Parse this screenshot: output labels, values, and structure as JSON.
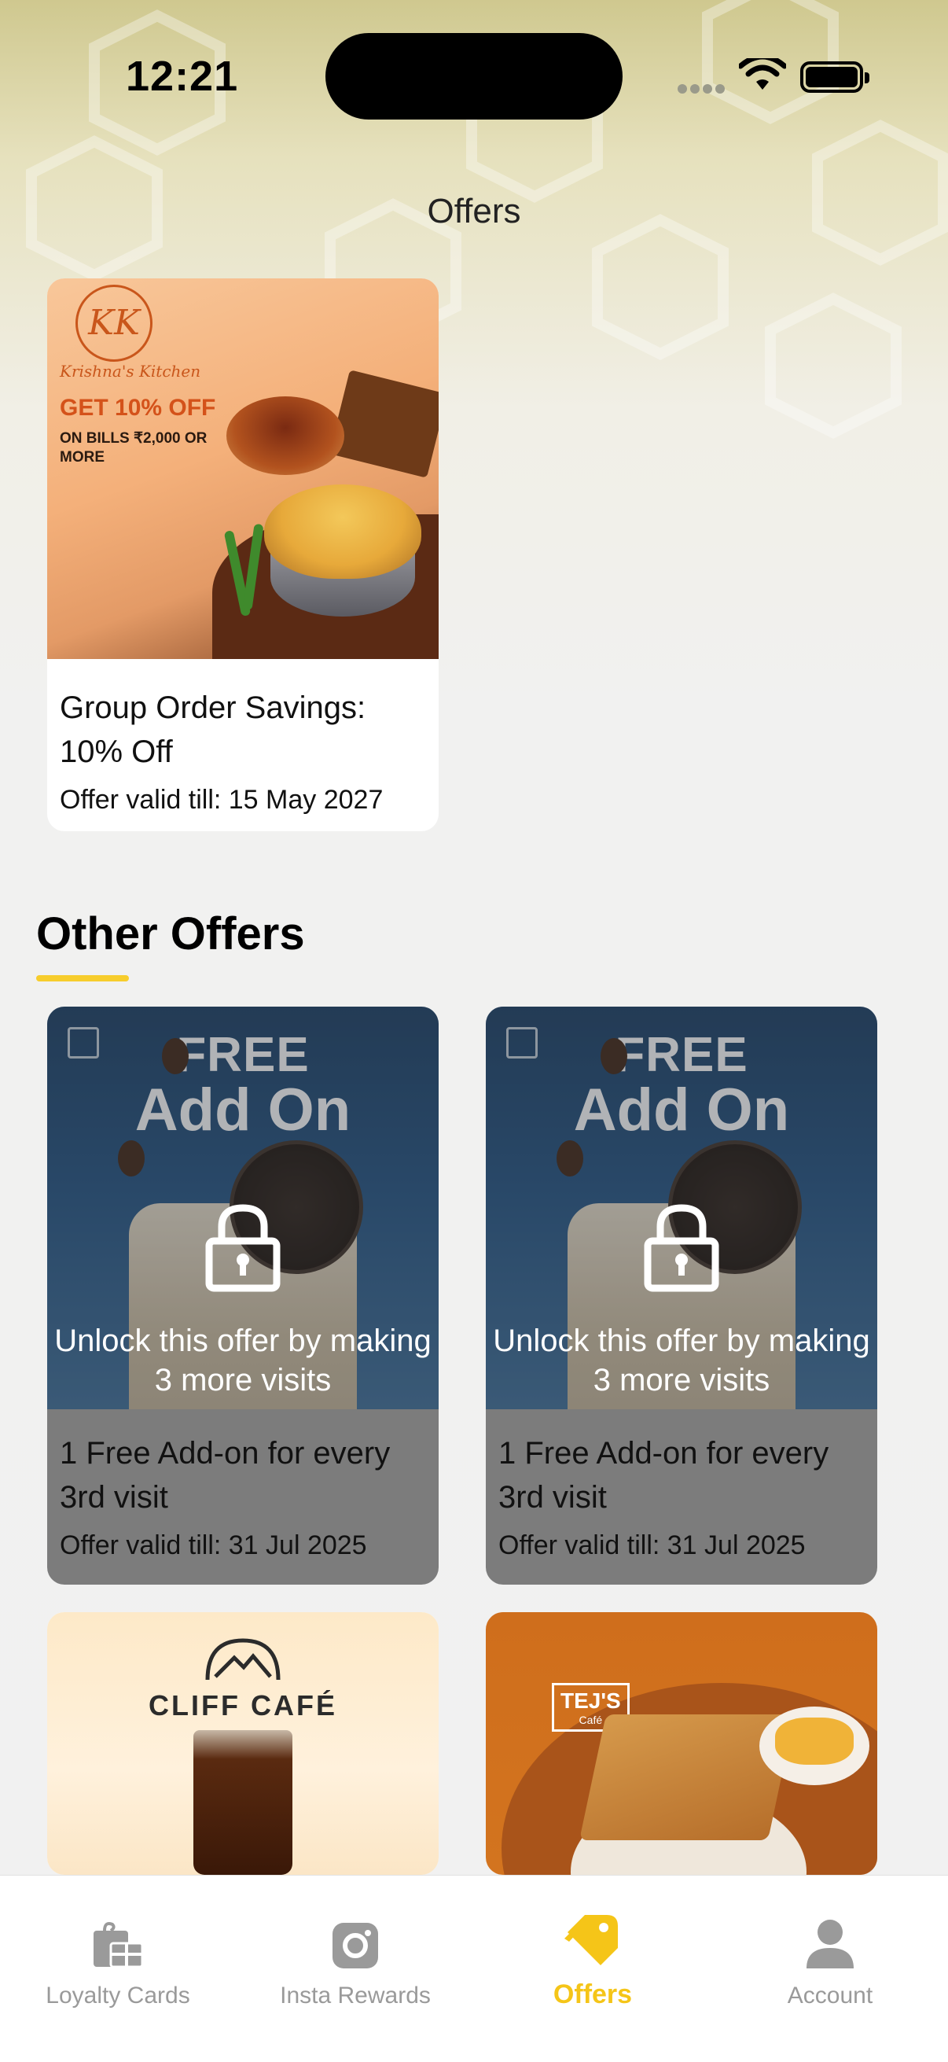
{
  "status_bar": {
    "time": "12:21"
  },
  "header": {
    "title": "Offers"
  },
  "featured_offer": {
    "brand": "Krishna's Kitchen",
    "logo_text": "KK",
    "banner_headline": "GET 10% OFF",
    "banner_sub": "ON BILLS ₹2,000 OR MORE",
    "title": "Group Order Savings: 10% Off",
    "valid": "Offer valid till: 15 May 2027"
  },
  "other_offers": {
    "heading": "Other Offers",
    "items": [
      {
        "banner_line1": "FREE",
        "banner_line2": "Add On",
        "lock_text": "Unlock this offer by making 3 more visits",
        "title": "1 Free Add-on for every 3rd visit",
        "valid": "Offer valid till: 31 Jul 2025",
        "locked": true
      },
      {
        "banner_line1": "FREE",
        "banner_line2": "Add On",
        "lock_text": "Unlock this offer by making 3 more visits",
        "title": "1 Free Add-on for every 3rd visit",
        "valid": "Offer valid till: 31 Jul 2025",
        "locked": true
      },
      {
        "brand": "CLIFF CAFÉ"
      },
      {
        "brand": "TEJ'S",
        "brand_sub": "Café"
      }
    ]
  },
  "bottom_nav": {
    "items": [
      {
        "label": "Loyalty Cards",
        "icon": "gift-card-icon",
        "active": false
      },
      {
        "label": "Insta Rewards",
        "icon": "instagram-icon",
        "active": false
      },
      {
        "label": "Offers",
        "icon": "tag-icon",
        "active": true
      },
      {
        "label": "Account",
        "icon": "user-icon",
        "active": false
      }
    ]
  },
  "colors": {
    "accent": "#f5c518",
    "inactive": "#9a9a9a",
    "lock_overlay": "#7c7c7c"
  }
}
